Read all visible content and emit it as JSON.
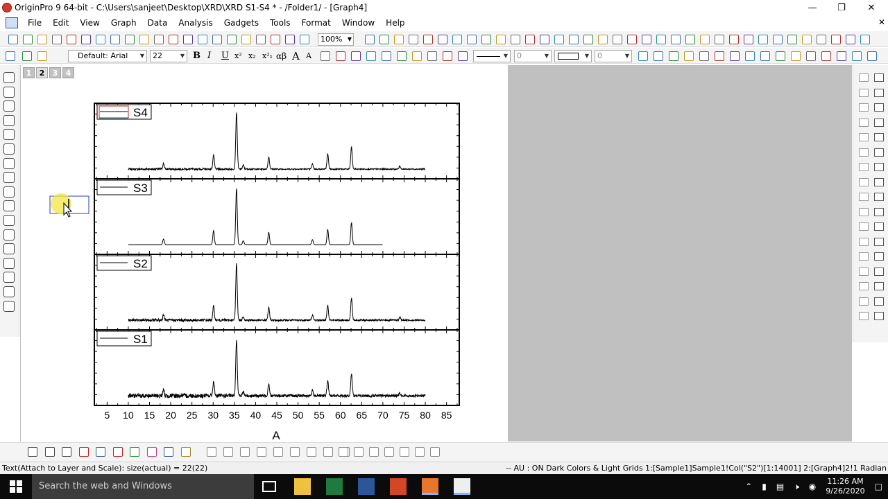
{
  "window": {
    "title": "OriginPro 9 64-bit - C:\\Users\\sanjeet\\Desktop\\XRD\\XRD S1-S4 * - /Folder1/ - [Graph4]"
  },
  "menu": [
    "File",
    "Edit",
    "View",
    "Graph",
    "Data",
    "Analysis",
    "Gadgets",
    "Tools",
    "Format",
    "Window",
    "Help"
  ],
  "toolbar": {
    "zoom": "100%",
    "font_name": "Default: Arial",
    "font_size": "22",
    "line_width": "0",
    "border_width": "0"
  },
  "format_buttons": {
    "bold": "B",
    "italic": "I",
    "underline": "U",
    "superscript": "x²",
    "subscript": "x₂",
    "supsub": "x²₁",
    "greek": "αβ",
    "grow": "A",
    "shrink": "A"
  },
  "layer_tabs": [
    "1",
    "2",
    "3",
    "4"
  ],
  "active_layer": "2",
  "chart_data": {
    "type": "line",
    "xlabel": "A",
    "xlim": [
      2,
      88
    ],
    "x_ticks": [
      "5",
      "10",
      "15",
      "20",
      "25",
      "30",
      "35",
      "40",
      "45",
      "50",
      "55",
      "60",
      "65",
      "70",
      "75",
      "80",
      "85"
    ],
    "x_range": [
      10,
      80
    ],
    "peaks": [
      {
        "x": 18.3,
        "h": 0.1
      },
      {
        "x": 30.1,
        "h": 0.25
      },
      {
        "x": 35.5,
        "h": 1.0
      },
      {
        "x": 37.1,
        "h": 0.07
      },
      {
        "x": 43.1,
        "h": 0.22
      },
      {
        "x": 53.4,
        "h": 0.09
      },
      {
        "x": 57.0,
        "h": 0.27
      },
      {
        "x": 62.6,
        "h": 0.39
      },
      {
        "x": 74.0,
        "h": 0.05
      }
    ],
    "series": [
      {
        "name": "S4",
        "noise": 0.035,
        "x_max": 80
      },
      {
        "name": "S3",
        "noise": 0.0,
        "x_max": 70
      },
      {
        "name": "S2",
        "noise": 0.05,
        "x_max": 80
      },
      {
        "name": "S1",
        "noise": 0.08,
        "x_max": 80
      }
    ]
  },
  "status": {
    "left": "Text(Attach to Layer and Scale): size(actual) = 22(22)",
    "right": "-- AU : ON  Dark Colors & Light Grids  1:[Sample1]Sample1!Col(\"S2\")[1:14001]  2:[Graph4]2!1  Radian"
  },
  "taskbar": {
    "search_placeholder": "Search the web and Windows",
    "time": "11:26 AM",
    "date": "9/26/2020"
  }
}
